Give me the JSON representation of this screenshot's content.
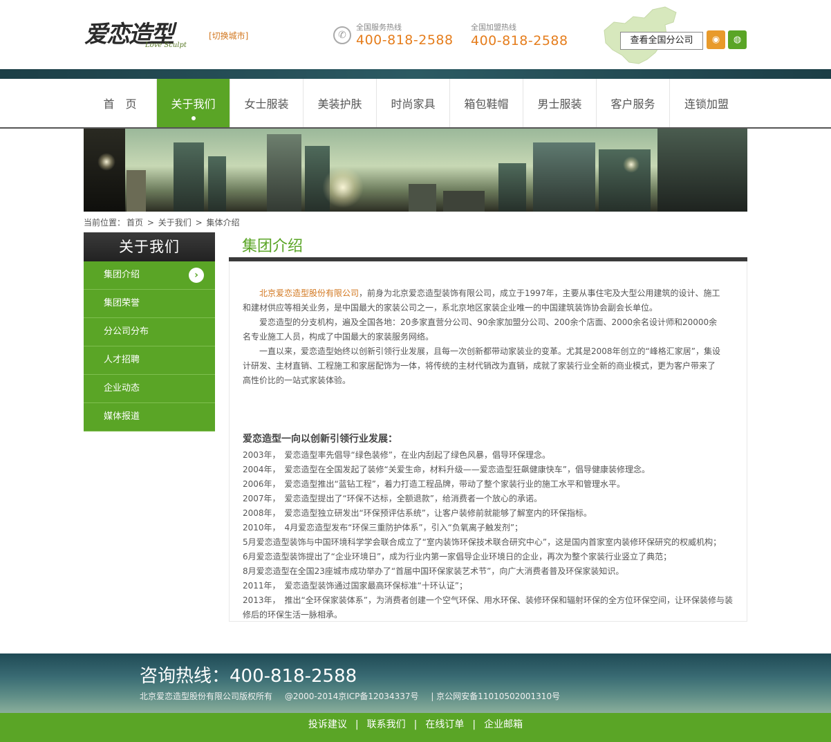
{
  "header": {
    "logo_text": "爱恋造型",
    "logo_sub": "Love Sculpt",
    "switch_city": "[切换城市]",
    "service_label": "全国服务热线",
    "service_number": "400-818-2588",
    "franchise_label": "全国加盟热线",
    "franchise_number": "400-818-2588",
    "branches_button": "查看全国分公司"
  },
  "nav": {
    "items": [
      {
        "label": "首　页",
        "active": false
      },
      {
        "label": "关于我们",
        "active": true
      },
      {
        "label": "女士服装",
        "active": false
      },
      {
        "label": "美装护肤",
        "active": false
      },
      {
        "label": "时尚家具",
        "active": false
      },
      {
        "label": "箱包鞋帽",
        "active": false
      },
      {
        "label": "男士服装",
        "active": false
      },
      {
        "label": "客户服务",
        "active": false
      },
      {
        "label": "连锁加盟",
        "active": false
      }
    ]
  },
  "breadcrumb": {
    "prefix": "当前位置：",
    "items": [
      "首页",
      "关于我们",
      "集体介绍"
    ],
    "separator": ">"
  },
  "sidebar": {
    "title": "关于我们",
    "items": [
      "集团介绍",
      "集团荣誉",
      "分公司分布",
      "人才招聘",
      "企业动态",
      "媒体报道"
    ],
    "arrow": "›"
  },
  "content": {
    "title": "集团介绍",
    "company_name": "北京爱恋造型股份有限公司",
    "p1_rest": "，前身为北京爱恋造型装饰有限公司，成立于1997年，主要从事住宅及大型公用建筑的设计、施工和建材供应等相关业务，是中国最大的家装公司之一，系北京地区家装企业唯一的中国建筑装饰协会副会长单位。",
    "p2": "爱恋造型的分支机构，遍及全国各地：20多家直营分公司、90余家加盟分公司、200余个店面、2000余名设计师和20000余名专业施工人员，构成了中国最大的家装服务网络。",
    "p3": "一直以来，爱恋造型始终以创新引领行业发展，且每一次创新都带动家装业的变革。尤其是2008年创立的“峰格汇家居”，集设计研发、主材直销、工程施工和家居配饰为一体，将传统的主材代销改为直销，成就了家装行业全新的商业模式，更为客户带来了高性价比的一站式家装体验。",
    "sub_head": "爱恋造型一向以创新引领行业发展：",
    "timeline": [
      "2003年，　爱恋造型率先倡导“绿色装修”，在业内刮起了绿色风暴，倡导环保理念。",
      "2004年，　爱恋造型在全国发起了装修“关爱生命，材料升级——爱恋造型狂飙健康快车”，倡导健康装修理念。",
      "2006年，　爱恋造型推出“蓝钻工程”，着力打造工程品牌，带动了整个家装行业的施工水平和管理水平。",
      "2007年，　爱恋造型提出了“环保不达标，全额退款”，给消费者一个放心的承诺。",
      "2008年，　爱恋造型独立研发出“环保预评估系统”，让客户装修前就能够了解室内的环保指标。",
      "2010年，　4月爱恋造型发布“环保三重防护体系”，引入“负氧离子触发剂”；",
      "5月爱恋造型装饰与中国环境科学学会联合成立了“室内装饰环保技术联合研究中心”，这是国内首家室内装修环保研究的权威机构；",
      "6月爱恋造型装饰提出了“企业环境日”，成为行业内第一家倡导企业环境日的企业，再次为整个家装行业竖立了典范；",
      "8月爱恋造型在全国23座城市成功举办了“首届中国环保家装艺术节”，向广大消费者普及环保家装知识。",
      "2011年，　爱恋造型装饰通过国家最高环保标准“十环认证”；",
      "2013年，　推出“全环保家装体系”，为消费者创建一个空气环保、用水环保、装修环保和辐射环保的全方位环保空间，让环保装修与装修后的环保生活一脉相承。"
    ]
  },
  "footer": {
    "hotline": "咨询热线：400-818-2588",
    "copyright": "北京爱恋造型股份有限公司版权所有",
    "icp": "@2000-2014京ICP备12034337号",
    "police": "| 京公网安备11010502001310号",
    "links": [
      "投诉建议",
      "联系我们",
      "在线订单",
      "企业邮箱"
    ],
    "separator": "|"
  },
  "colors": {
    "brand_green": "#5aa526",
    "accent_orange": "#e57d1c",
    "dark_bar": "#1c3e46"
  },
  "icons": {
    "phone": "phone-icon",
    "weibo": "weibo-icon",
    "wechat": "wechat-icon",
    "map": "china-map-icon"
  }
}
